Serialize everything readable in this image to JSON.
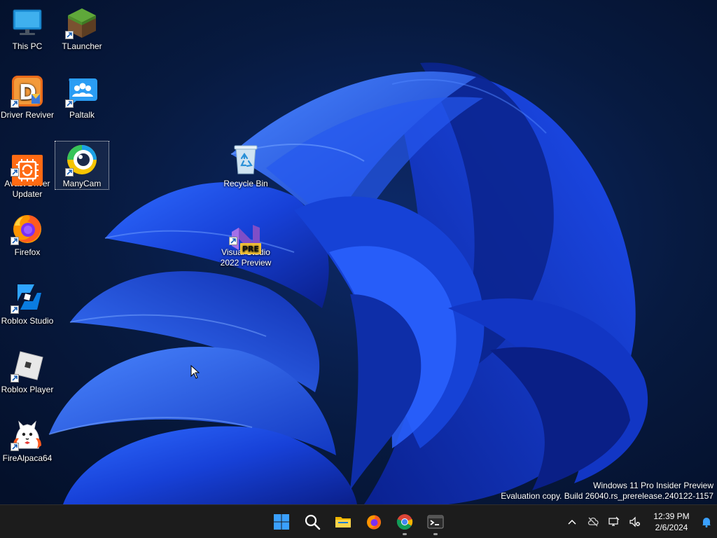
{
  "desktop": {
    "icons": [
      {
        "label": "This PC"
      },
      {
        "label": "TLauncher"
      },
      {
        "label": "Driver Reviver"
      },
      {
        "label": "Paltalk"
      },
      {
        "label": "Avast Driver\nUpdater"
      },
      {
        "label": "ManyCam"
      },
      {
        "label": "Recycle Bin"
      },
      {
        "label": "Visual Studio\n2022 Preview"
      },
      {
        "label": "Firefox"
      },
      {
        "label": "Roblox Studio"
      },
      {
        "label": "Roblox Player"
      },
      {
        "label": "FireAlpaca64"
      }
    ],
    "vs_badge": "PRE"
  },
  "watermark": {
    "line1": "Windows 11 Pro Insider Preview",
    "line2": "Evaluation copy. Build 26040.rs_prerelease.240122-1157"
  },
  "taskbar": {
    "apps": [
      "Start",
      "Search",
      "File Explorer",
      "Firefox",
      "Google Chrome",
      "Terminal"
    ],
    "clock": {
      "time": "12:39 PM",
      "date": "2/6/2024"
    }
  },
  "colors": {
    "taskbar_bg": "#1c1c1c",
    "wallpaper_base": "#071530",
    "accent": "#0067c0"
  }
}
